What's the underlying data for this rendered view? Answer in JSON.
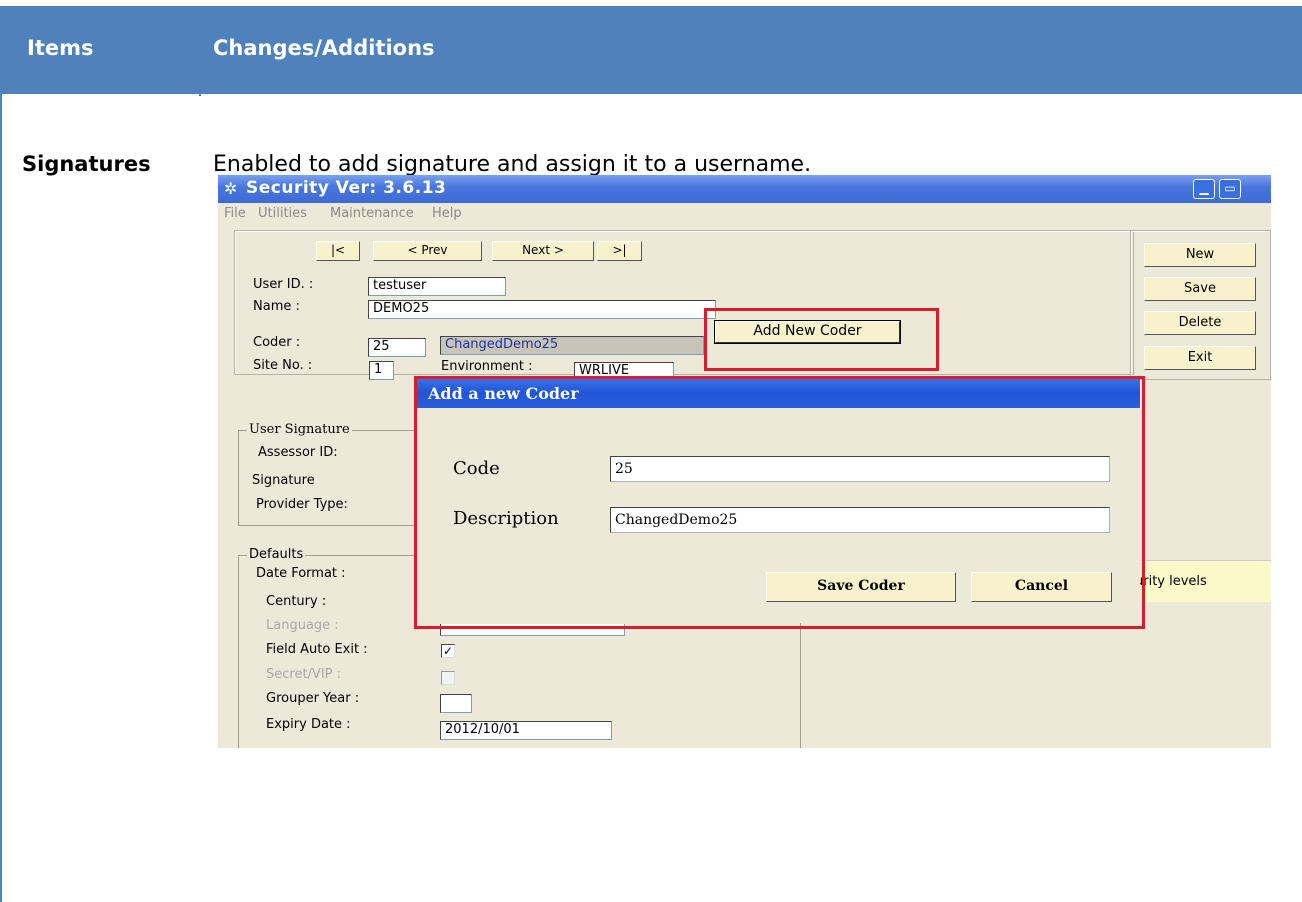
{
  "table": {
    "header_items": "Items",
    "header_changes": "Changes/Additions",
    "row_label": "Signatures",
    "row_text": "Enabled to add signature and assign it to a username."
  },
  "window": {
    "title": "Security Ver: 3.6.13",
    "menu": [
      "File",
      "Utilities",
      "Maintenance",
      "Help"
    ]
  },
  "nav": {
    "first": "|<",
    "prev": "< Prev",
    "next": "Next >",
    "last": ">|"
  },
  "form": {
    "user_id_label": "User ID. :",
    "user_id_value": "testuser",
    "name_label": "Name :",
    "name_value": "DEMO25",
    "coder_label": "Coder :",
    "coder_code": "25",
    "coder_desc": "ChangedDemo25",
    "add_coder_button": "Add New Coder",
    "site_label": "Site No. :",
    "site_value": "1",
    "env_label": "Environment :",
    "env_value": "WRLIVE"
  },
  "side_buttons": {
    "new": "New",
    "save": "Save",
    "delete": "Delete",
    "exit": "Exit"
  },
  "signature_group": {
    "title": "User Signature",
    "assessor_label": "Assessor ID:",
    "signature_label": "Signature",
    "provider_label": "Provider Type:"
  },
  "defaults_group": {
    "title": "Defaults",
    "date_format_label": "Date Format :",
    "century_label": "Century :",
    "language_label": "Language :",
    "field_auto_exit_label": "Field Auto Exit :",
    "field_auto_exit_checked": true,
    "secret_vip_label": "Secret/VIP :",
    "grouper_year_label": "Grouper Year :",
    "expiry_label": "Expiry Date :",
    "expiry_value": "2012/10/01"
  },
  "security_strip": "urity levels",
  "dialog": {
    "title": "Add a new Coder",
    "code_label": "Code",
    "code_value": "25",
    "description_label": "Description",
    "description_value": "ChangedDemo25",
    "save_button": "Save Coder",
    "cancel_button": "Cancel"
  },
  "colors": {
    "header_blue": "#4f81bd",
    "highlight_red": "#dc1c2a",
    "xp_title_blue": "#1f55d6",
    "button_cream": "#f7f2cc"
  }
}
